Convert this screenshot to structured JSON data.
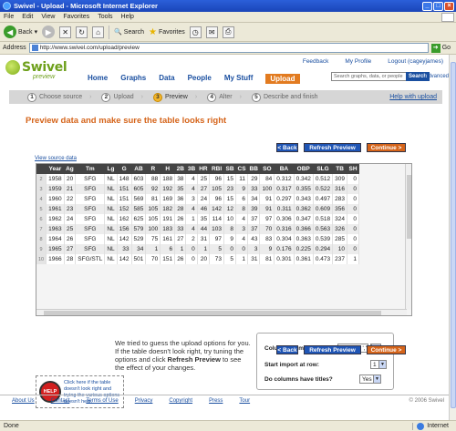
{
  "window": {
    "title": "Swivel - Upload - Microsoft Internet Explorer"
  },
  "menu": [
    "File",
    "Edit",
    "View",
    "Favorites",
    "Tools",
    "Help"
  ],
  "toolbar": {
    "back": "Back",
    "search": "Search",
    "favorites": "Favorites"
  },
  "address": {
    "label": "Address",
    "url": "http://www.swivel.com/upload/preview",
    "go": "Go"
  },
  "site": {
    "logo": "Swivel",
    "logo_sub": "preview",
    "toplinks": [
      "Feedback",
      "My Profile",
      "Logout (cageyjames)"
    ],
    "nav": [
      "Home",
      "Graphs",
      "Data",
      "People",
      "My Stuff",
      "Upload"
    ],
    "search_placeholder": "Search graphs, data, or people",
    "search_button": "Search",
    "advanced": "Advanced"
  },
  "steps": [
    {
      "num": "1",
      "label": "Choose source"
    },
    {
      "num": "2",
      "label": "Upload"
    },
    {
      "num": "3",
      "label": "Preview"
    },
    {
      "num": "4",
      "label": "Alter"
    },
    {
      "num": "5",
      "label": "Describe and finish"
    }
  ],
  "help_upload": "Help with upload",
  "heading": "Preview data and make sure the table looks right",
  "buttons": {
    "back": "< Back",
    "refresh": "Refresh Preview",
    "continue": "Continue >"
  },
  "view_source": "View source data",
  "table": {
    "columns": [
      "",
      "Year",
      "Ag",
      "Tm",
      "Lg",
      "G",
      "AB",
      "R",
      "H",
      "2B",
      "3B",
      "HR",
      "RBI",
      "SB",
      "CS",
      "BB",
      "SO",
      "BA",
      "OBP",
      "SLG",
      "TB",
      "SH"
    ],
    "rows": [
      [
        "2",
        "1958",
        "20",
        "SFG",
        "NL",
        "148",
        "603",
        "88",
        "188",
        "38",
        "4",
        "25",
        "96",
        "15",
        "11",
        "29",
        "84",
        "0.312",
        "0.342",
        "0.512",
        "309",
        "0"
      ],
      [
        "3",
        "1959",
        "21",
        "SFG",
        "NL",
        "151",
        "605",
        "92",
        "192",
        "35",
        "4",
        "27",
        "105",
        "23",
        "9",
        "33",
        "100",
        "0.317",
        "0.355",
        "0.522",
        "316",
        "0"
      ],
      [
        "4",
        "1960",
        "22",
        "SFG",
        "NL",
        "151",
        "569",
        "81",
        "169",
        "36",
        "3",
        "24",
        "96",
        "15",
        "6",
        "34",
        "91",
        "0.297",
        "0.343",
        "0.497",
        "283",
        "0"
      ],
      [
        "5",
        "1961",
        "23",
        "SFG",
        "NL",
        "152",
        "585",
        "105",
        "182",
        "28",
        "4",
        "46",
        "142",
        "12",
        "8",
        "39",
        "91",
        "0.311",
        "0.362",
        "0.609",
        "356",
        "0"
      ],
      [
        "6",
        "1962",
        "24",
        "SFG",
        "NL",
        "162",
        "625",
        "105",
        "191",
        "26",
        "1",
        "35",
        "114",
        "10",
        "4",
        "37",
        "97",
        "0.306",
        "0.347",
        "0.518",
        "324",
        "0"
      ],
      [
        "7",
        "1963",
        "25",
        "SFG",
        "NL",
        "156",
        "579",
        "100",
        "183",
        "33",
        "4",
        "44",
        "103",
        "8",
        "3",
        "37",
        "70",
        "0.316",
        "0.366",
        "0.563",
        "326",
        "0"
      ],
      [
        "8",
        "1964",
        "26",
        "SFG",
        "NL",
        "142",
        "529",
        "75",
        "161",
        "27",
        "2",
        "31",
        "97",
        "9",
        "4",
        "43",
        "83",
        "0.304",
        "0.363",
        "0.539",
        "285",
        "0"
      ],
      [
        "9",
        "1965",
        "27",
        "SFG",
        "NL",
        "33",
        "34",
        "1",
        "6",
        "1",
        "0",
        "1",
        "5",
        "0",
        "0",
        "3",
        "9",
        "0.176",
        "0.225",
        "0.294",
        "10",
        "0"
      ],
      [
        "10",
        "1966",
        "28",
        "SFG/STL",
        "NL",
        "142",
        "501",
        "70",
        "151",
        "26",
        "0",
        "20",
        "73",
        "5",
        "1",
        "31",
        "81",
        "0.301",
        "0.361",
        "0.473",
        "237",
        "1"
      ]
    ]
  },
  "explain": {
    "part1": "We tried to guess the upload options for you. If the table doesn't look right, try tuning the options and click ",
    "bold": "Refresh Preview",
    "part2": " to see the effect of your changes."
  },
  "help_box": {
    "icon_label": "HELP",
    "text": "Click here if the table doesn't look right and trying the various options doesn't help."
  },
  "options": {
    "delimiter_label": "Column delimiter",
    "delimiter_value": "Comma ','",
    "start_row_label": "Start import at row:",
    "start_row_value": "1",
    "titles_label": "Do columns have titles?",
    "titles_value": "Yes"
  },
  "footer": {
    "links": [
      "About Us",
      "Contact",
      "Terms of Use",
      "Privacy",
      "Copyright",
      "Press",
      "Tour"
    ],
    "copyright": "© 2006 Swivel"
  },
  "status": {
    "left": "Done",
    "zone": "Internet"
  }
}
